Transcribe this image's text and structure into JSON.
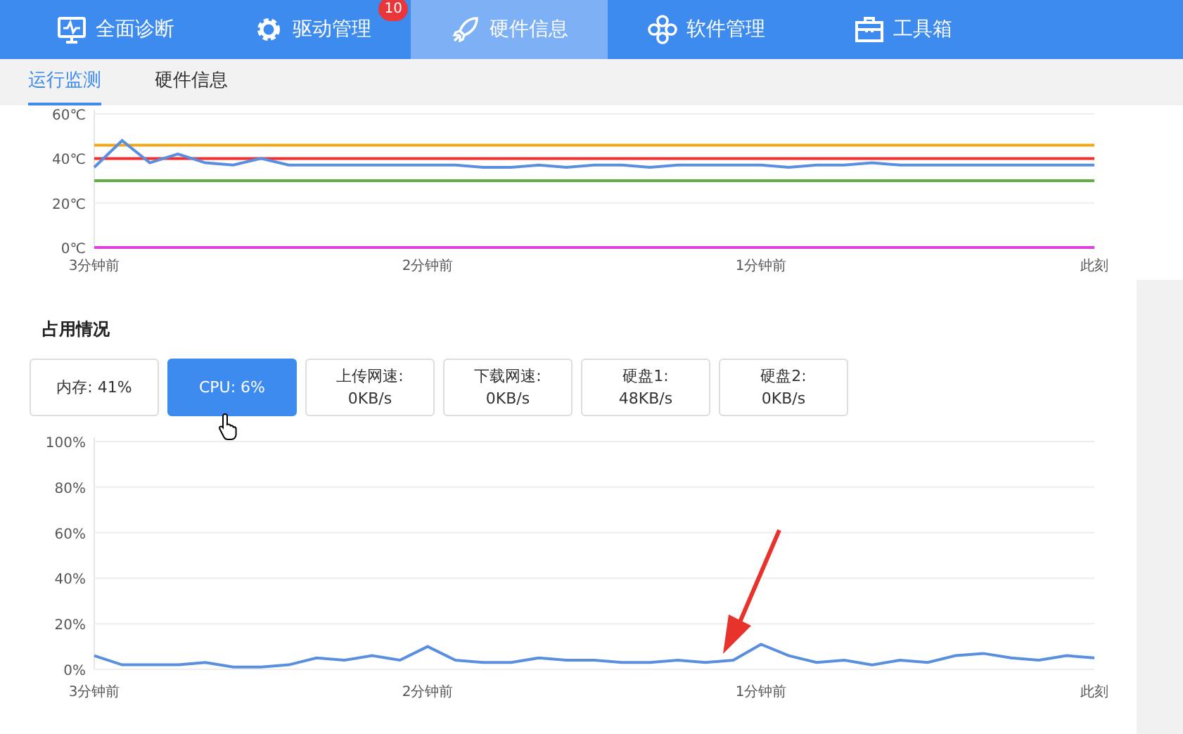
{
  "nav_tabs": [
    {
      "label": "全面诊断",
      "selected": false
    },
    {
      "label": "驱动管理",
      "selected": false,
      "badge": "10"
    },
    {
      "label": "硬件信息",
      "selected": true
    },
    {
      "label": "软件管理",
      "selected": false
    },
    {
      "label": "工具箱",
      "selected": false
    }
  ],
  "sub_tabs": [
    {
      "label": "运行监测",
      "selected": true
    },
    {
      "label": "硬件信息",
      "selected": false
    }
  ],
  "temperature_chart": {
    "chart_data": {
      "type": "line",
      "ylim": [
        0,
        60
      ],
      "yticks": [
        {
          "value": 0,
          "label": "0℃"
        },
        {
          "value": 20,
          "label": "20℃"
        },
        {
          "value": 40,
          "label": "40℃"
        },
        {
          "value": 60,
          "label": "60℃"
        }
      ],
      "grid": true,
      "categories": [
        "3分钟前",
        null,
        null,
        null,
        null,
        null,
        null,
        null,
        null,
        null,
        null,
        null,
        "2分钟前",
        null,
        null,
        null,
        null,
        null,
        null,
        null,
        null,
        null,
        null,
        null,
        "1分钟前",
        null,
        null,
        null,
        null,
        null,
        null,
        null,
        null,
        null,
        null,
        null,
        "此刻"
      ],
      "series": [
        {
          "color": "#f0a818",
          "values": [
            46,
            46,
            46,
            46,
            46,
            46,
            46,
            46,
            46,
            46,
            46,
            46,
            46,
            46,
            46,
            46,
            46,
            46,
            46,
            46,
            46,
            46,
            46,
            46,
            46,
            46,
            46,
            46,
            46,
            46,
            46,
            46,
            46,
            46,
            46,
            46,
            46
          ]
        },
        {
          "color": "#f03030",
          "values": [
            40,
            40,
            40,
            40,
            40,
            40,
            40,
            40,
            40,
            40,
            40,
            40,
            40,
            40,
            40,
            40,
            40,
            40,
            40,
            40,
            40,
            40,
            40,
            40,
            40,
            40,
            40,
            40,
            40,
            40,
            40,
            40,
            40,
            40,
            40,
            40,
            40
          ]
        },
        {
          "color": "#5fb040",
          "values": [
            30,
            30,
            30,
            30,
            30,
            30,
            30,
            30,
            30,
            30,
            30,
            30,
            30,
            30,
            30,
            30,
            30,
            30,
            30,
            30,
            30,
            30,
            30,
            30,
            30,
            30,
            30,
            30,
            30,
            30,
            30,
            30,
            30,
            30,
            30,
            30,
            30
          ]
        },
        {
          "color": "#e040e0",
          "values": [
            0,
            0,
            0,
            0,
            0,
            0,
            0,
            0,
            0,
            0,
            0,
            0,
            0,
            0,
            0,
            0,
            0,
            0,
            0,
            0,
            0,
            0,
            0,
            0,
            0,
            0,
            0,
            0,
            0,
            0,
            0,
            0,
            0,
            0,
            0,
            0,
            0
          ]
        },
        {
          "color": "#5a8fdf",
          "values": [
            36,
            48,
            38,
            42,
            38,
            37,
            40,
            37,
            37,
            37,
            37,
            37,
            37,
            37,
            36,
            36,
            37,
            36,
            37,
            37,
            36,
            37,
            37,
            37,
            37,
            36,
            37,
            37,
            38,
            37,
            37,
            37,
            37,
            37,
            37,
            37,
            37
          ]
        }
      ]
    }
  },
  "usage": {
    "title": "占用情况",
    "cards": [
      {
        "lines": [
          "内存: 41%"
        ],
        "selected": false
      },
      {
        "lines": [
          "CPU: 6%"
        ],
        "selected": true
      },
      {
        "lines": [
          "上传网速:",
          "0KB/s"
        ],
        "selected": false
      },
      {
        "lines": [
          "下载网速:",
          "0KB/s"
        ],
        "selected": false
      },
      {
        "lines": [
          "硬盘1:",
          "48KB/s"
        ],
        "selected": false
      },
      {
        "lines": [
          "硬盘2:",
          "0KB/s"
        ],
        "selected": false
      }
    ],
    "chart_data": {
      "type": "line",
      "ylim": [
        0,
        100
      ],
      "yticks": [
        {
          "value": 0,
          "label": "0%"
        },
        {
          "value": 20,
          "label": "20%"
        },
        {
          "value": 40,
          "label": "40%"
        },
        {
          "value": 60,
          "label": "60%"
        },
        {
          "value": 80,
          "label": "80%"
        },
        {
          "value": 100,
          "label": "100%"
        }
      ],
      "grid": true,
      "categories": [
        "3分钟前",
        null,
        null,
        null,
        null,
        null,
        null,
        null,
        null,
        null,
        null,
        null,
        "2分钟前",
        null,
        null,
        null,
        null,
        null,
        null,
        null,
        null,
        null,
        null,
        null,
        "1分钟前",
        null,
        null,
        null,
        null,
        null,
        null,
        null,
        null,
        null,
        null,
        null,
        "此刻"
      ],
      "series": [
        {
          "color": "#5a8fdf",
          "values": [
            6,
            2,
            2,
            2,
            3,
            1,
            1,
            2,
            5,
            4,
            6,
            4,
            10,
            4,
            3,
            3,
            5,
            4,
            4,
            3,
            3,
            4,
            3,
            4,
            11,
            6,
            3,
            4,
            2,
            4,
            3,
            6,
            7,
            5,
            4,
            6,
            5
          ]
        }
      ]
    }
  }
}
